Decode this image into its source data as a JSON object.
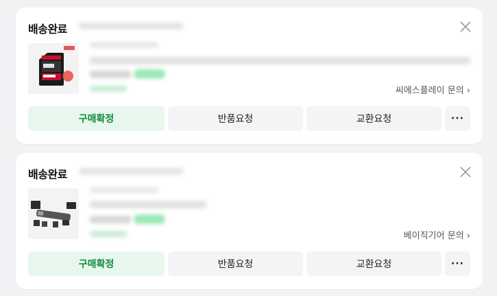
{
  "orders": [
    {
      "status": "배송완료",
      "seller_inquiry": "씨에스플레이 문의",
      "product": "sd-card-image",
      "buttons": {
        "confirm": "구매확정",
        "return": "반품요청",
        "exchange": "교환요청",
        "more": "···"
      }
    },
    {
      "status": "배송완료",
      "seller_inquiry": "베이직기어 문의",
      "product": "card-reader-image",
      "buttons": {
        "confirm": "구매확정",
        "return": "반품요청",
        "exchange": "교환요청",
        "more": "···"
      }
    }
  ],
  "colors": {
    "accent_green": "#0c8a3f",
    "accent_green_bg": "#e8f7ee",
    "button_bg": "#f3f4f6",
    "page_bg": "#f1f2f4"
  }
}
